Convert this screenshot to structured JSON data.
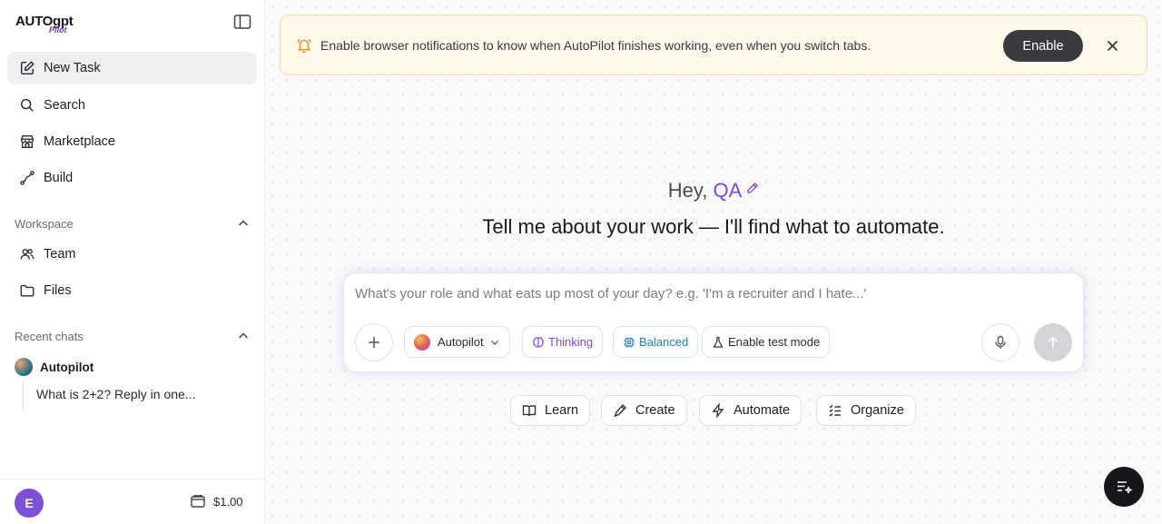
{
  "brand": {
    "wordmark": "AUTOgpt",
    "sub": "Pilot"
  },
  "sidebar": {
    "nav": [
      {
        "label": "New Task",
        "icon": "compose-icon"
      },
      {
        "label": "Search",
        "icon": "search-icon"
      },
      {
        "label": "Marketplace",
        "icon": "store-icon"
      },
      {
        "label": "Build",
        "icon": "flow-icon"
      }
    ],
    "workspace": {
      "title": "Workspace",
      "items": [
        {
          "label": "Team",
          "icon": "users-icon"
        },
        {
          "label": "Files",
          "icon": "folder-icon"
        }
      ]
    },
    "recent": {
      "title": "Recent chats",
      "agent": "Autopilot",
      "threads": [
        "What is 2+2? Reply in one..."
      ]
    },
    "footer": {
      "avatar_letter": "E",
      "balance": "$1.00"
    }
  },
  "banner": {
    "message": "Enable browser notifications to know when AutoPilot finishes working, even when you switch tabs.",
    "enable_label": "Enable"
  },
  "hero": {
    "greeting": "Hey,",
    "name": "QA",
    "headline": "Tell me about your work — I'll find what to automate."
  },
  "composer": {
    "placeholder": "What's your role and what eats up most of your day? e.g. 'I'm a recruiter and I hate...'",
    "value": "",
    "model": "Autopilot",
    "thinking": "Thinking",
    "balanced": "Balanced",
    "test_mode": "Enable test mode"
  },
  "chips": [
    "Learn",
    "Create",
    "Automate",
    "Organize"
  ],
  "colors": {
    "accent": "#7c48dd",
    "banner_bg": "#fff8eb",
    "balanced": "#1f7fb8",
    "dark_button": "#3a3a3f"
  }
}
